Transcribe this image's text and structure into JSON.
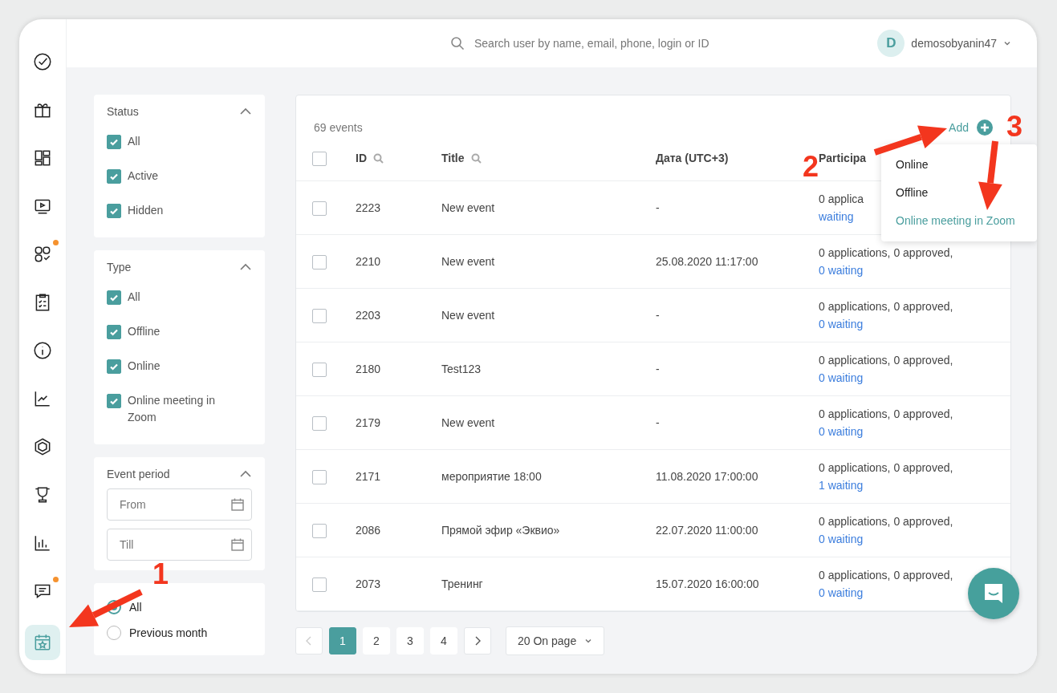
{
  "sidebar": {
    "items": [
      {
        "selected": false,
        "badge": false
      },
      {
        "selected": false,
        "badge": false
      },
      {
        "selected": false,
        "badge": false
      },
      {
        "selected": false,
        "badge": false
      },
      {
        "selected": false,
        "badge": true
      },
      {
        "selected": false,
        "badge": false
      },
      {
        "selected": false,
        "badge": false
      },
      {
        "selected": false,
        "badge": false
      },
      {
        "selected": false,
        "badge": false
      },
      {
        "selected": false,
        "badge": false
      },
      {
        "selected": false,
        "badge": false
      },
      {
        "selected": false,
        "badge": true
      },
      {
        "selected": true,
        "badge": false
      }
    ]
  },
  "topbar": {
    "search": {
      "placeholder": "Search user by name, email, phone, login or ID"
    },
    "user": {
      "initial": "D",
      "name": "demosobyanin47"
    }
  },
  "filters": {
    "status": {
      "title": "Status",
      "expanded": true,
      "options": [
        {
          "label": "All",
          "checked": true
        },
        {
          "label": "Active",
          "checked": true
        },
        {
          "label": "Hidden",
          "checked": true
        }
      ]
    },
    "type": {
      "title": "Type",
      "expanded": true,
      "options": [
        {
          "label": "All",
          "checked": true
        },
        {
          "label": "Offline",
          "checked": true
        },
        {
          "label": "Online",
          "checked": true
        },
        {
          "label": "Online meeting in Zoom",
          "checked": true
        }
      ]
    },
    "event_period": {
      "title": "Event period",
      "expanded": true,
      "from": {
        "placeholder": "From"
      },
      "till": {
        "placeholder": "Till"
      }
    },
    "period_options": [
      {
        "label": "All",
        "selected": true
      },
      {
        "label": "Previous month",
        "selected": false
      }
    ]
  },
  "events": {
    "count": "69 events",
    "add": "Add",
    "add_menu": [
      {
        "label": "Online",
        "selected": false
      },
      {
        "label": "Offline",
        "selected": false
      },
      {
        "label": "Online meeting in Zoom",
        "selected": true
      }
    ],
    "select_all": {
      "checked": false
    },
    "columns": [
      "ID",
      "Title",
      "Дата (UTC+3)",
      "Participa"
    ],
    "rows": [
      {
        "checked": false,
        "id": "2223",
        "title": "New event",
        "date": "-",
        "participants": "0 applica",
        "waiting": "waiting"
      },
      {
        "checked": false,
        "id": "2210",
        "title": "New event",
        "date": "25.08.2020 11:17:00",
        "participants": "0 applications, 0 approved,",
        "waiting": "0 waiting"
      },
      {
        "checked": false,
        "id": "2203",
        "title": "New event",
        "date": "-",
        "participants": "0 applications, 0 approved,",
        "waiting": "0 waiting"
      },
      {
        "checked": false,
        "id": "2180",
        "title": "Test123",
        "date": "-",
        "participants": "0 applications, 0 approved,",
        "waiting": "0 waiting"
      },
      {
        "checked": false,
        "id": "2179",
        "title": "New event",
        "date": "-",
        "participants": "0 applications, 0 approved,",
        "waiting": "0 waiting"
      },
      {
        "checked": false,
        "id": "2171",
        "title": "мероприятие 18:00",
        "date": "11.08.2020 17:00:00",
        "participants": "0 applications, 0 approved,",
        "waiting": "1 waiting"
      },
      {
        "checked": false,
        "id": "2086",
        "title": "Прямой эфир «Эквио»",
        "date": "22.07.2020 11:00:00",
        "participants": "0 applications, 0 approved,",
        "waiting": "0 waiting"
      },
      {
        "checked": false,
        "id": "2073",
        "title": "Тренинг",
        "date": "15.07.2020 16:00:00",
        "participants": "0 applications, 0 approved,",
        "waiting": "0 waiting"
      }
    ]
  },
  "pagination": {
    "prev_disabled": true,
    "pages": [
      {
        "label": "1",
        "selected": true
      },
      {
        "label": "2",
        "selected": false
      },
      {
        "label": "3",
        "selected": false
      },
      {
        "label": "4",
        "selected": false
      }
    ],
    "page_size": "20 On page"
  },
  "annotations": [
    "1",
    "2",
    "3"
  ]
}
